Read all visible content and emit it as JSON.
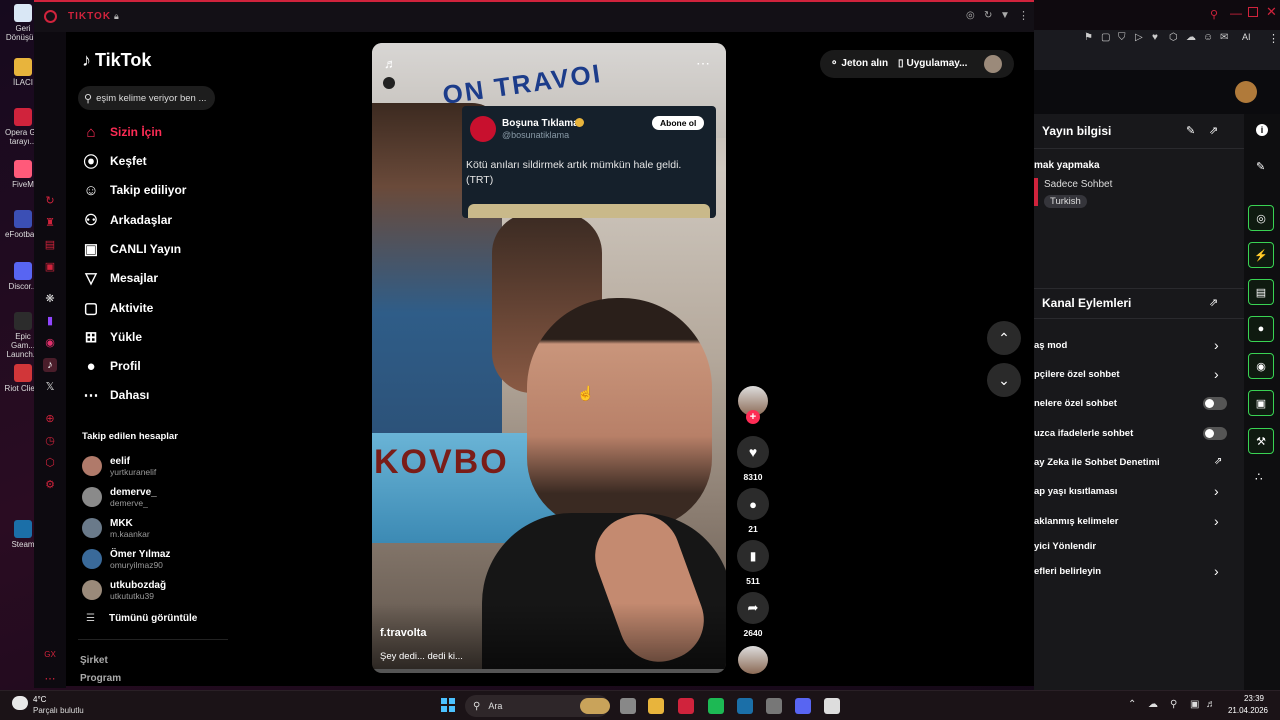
{
  "desktop": {
    "icons": [
      {
        "label": "Geri Dönüşü...",
        "color": "#d9e7f5"
      },
      {
        "label": "İLACI",
        "color": "#e8b43c"
      },
      {
        "label": "Opera GX tarayı...",
        "color": "#d0233c"
      },
      {
        "label": "FiveM",
        "color": "#ff5a7a"
      },
      {
        "label": "eFootba...",
        "color": "#3b4fb5"
      },
      {
        "label": "Discor...",
        "color": "#5865f2"
      },
      {
        "label": "Epic Gam... Launch...",
        "color": "#2c2c2c"
      },
      {
        "label": "Riot Clie...",
        "color": "#d13639"
      },
      {
        "label": "Steam",
        "color": "#1b6fa8"
      }
    ]
  },
  "browser": {
    "title": "TIKTOK",
    "lock_icon": "lock-icon",
    "controls": [
      "settings-icon",
      "reload-icon",
      "pin-icon",
      "more-icon"
    ]
  },
  "tiktok": {
    "logo": "TikTok",
    "search_placeholder": "eşim kelime veriyor ben ...",
    "nav": [
      {
        "label": "Sizin İçin",
        "icon": "home-icon",
        "active": true
      },
      {
        "label": "Keşfet",
        "icon": "compass-icon"
      },
      {
        "label": "Takip ediliyor",
        "icon": "following-icon"
      },
      {
        "label": "Arkadaşlar",
        "icon": "friends-icon"
      },
      {
        "label": "CANLI Yayın",
        "icon": "live-icon"
      },
      {
        "label": "Mesajlar",
        "icon": "messages-icon"
      },
      {
        "label": "Aktivite",
        "icon": "activity-icon"
      },
      {
        "label": "Yükle",
        "icon": "upload-icon"
      },
      {
        "label": "Profil",
        "icon": "profile-icon"
      },
      {
        "label": "Dahası",
        "icon": "more-icon"
      }
    ],
    "following_title": "Takip edilen hesaplar",
    "following": [
      {
        "name": "eelif",
        "handle": "yurtkuranelif",
        "color": "#b07a6a"
      },
      {
        "name": "demerve_",
        "handle": "demerve_",
        "color": "#8a8a8a"
      },
      {
        "name": "MKK",
        "handle": "m.kaankar",
        "color": "#6a7a8a"
      },
      {
        "name": "Ömer Yılmaz",
        "handle": "omuryilmaz90",
        "color": "#3a6a9a"
      },
      {
        "name": "utkubozdağ",
        "handle": "utkututku39",
        "color": "#9a8a7a"
      }
    ],
    "see_all": "Tümünü görüntüle",
    "footer": [
      "Şirket",
      "Program"
    ],
    "top_right": {
      "coins": "Jeton alın",
      "app": "Uygulamay..."
    },
    "video": {
      "author": "f.travolta",
      "caption": "Şey dedi... dedi ki...",
      "tweet": {
        "name": "Boşuna Tıklama",
        "handle": "@bosunatiklama",
        "follow": "Abone ol",
        "text": "Kötü anıları sildirmek artık mümkün hale geldi. (TRT)"
      },
      "poster_top": "ON TRAVOI",
      "poster_bottom": "KOVBO"
    },
    "actions": {
      "likes": "8310",
      "comments": "21",
      "saves": "511",
      "shares": "2640"
    }
  },
  "stream_panel": {
    "info_title": "Yayın bilgisi",
    "stream_title": "mak yapmaka",
    "category": "Sadece Sohbet",
    "tag": "Turkish",
    "actions_title": "Kanal Eylemleri",
    "rows": [
      {
        "label": "aş mod",
        "control": "chevron"
      },
      {
        "label": "pçilere özel sohbet",
        "control": "chevron"
      },
      {
        "label": "nelere özel sohbet",
        "control": "toggle"
      },
      {
        "label": "uzca ifadelerle sohbet",
        "control": "toggle"
      },
      {
        "label": "ay Zeka ile Sohbet Denetimi",
        "control": "external"
      },
      {
        "label": "ap yaşı kısıtlaması",
        "control": "chevron"
      },
      {
        "label": "aklanmış kelimeler",
        "control": "chevron"
      },
      {
        "label": "yici Yönlendir",
        "control": "none"
      },
      {
        "label": "efleri belirleyin",
        "control": "chevron"
      }
    ],
    "toolbar_ai": "AI"
  },
  "taskbar": {
    "weather_temp": "4°C",
    "weather_desc": "Parçalı bulutlu",
    "search": "Ara",
    "time": "23:39",
    "date": "21.04.2026"
  }
}
